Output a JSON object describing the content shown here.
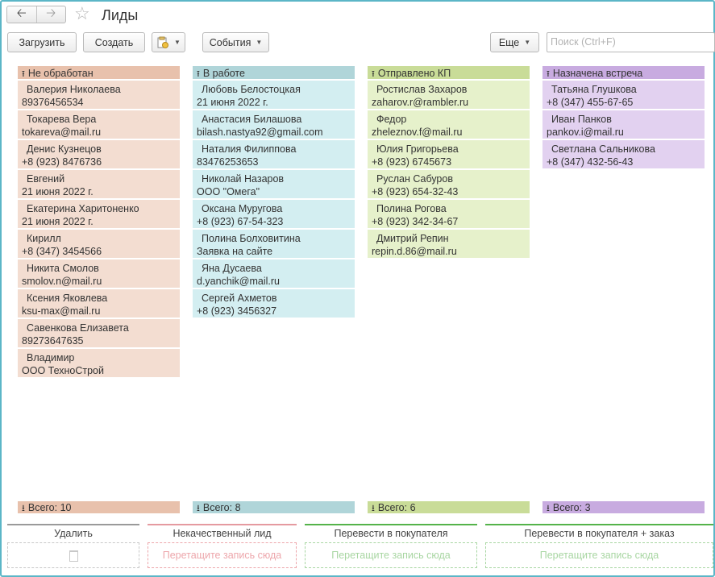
{
  "window": {
    "title": "Лиды"
  },
  "toolbar": {
    "load_label": "Загрузить",
    "create_label": "Создать",
    "events_label": "События",
    "more_label": "Еще",
    "search_placeholder": "Поиск (Ctrl+F)"
  },
  "columns": [
    {
      "title": "Не обработан",
      "total": "Всего: 10",
      "color": "#e8c1ac",
      "cards": [
        {
          "name": "Валерия Николаева",
          "contact": "89376456534"
        },
        {
          "name": "Токарева Вера",
          "contact": "tokareva@mail.ru"
        },
        {
          "name": "Денис Кузнецов",
          "contact": "+8 (923) 8476736"
        },
        {
          "name": "Евгений",
          "contact": "21 июня 2022 г."
        },
        {
          "name": "Екатерина Харитоненко",
          "contact": "21 июня 2022 г."
        },
        {
          "name": "Кирилл",
          "contact": "+8 (347) 3454566"
        },
        {
          "name": "Никита Смолов",
          "contact": "smolov.n@mail.ru"
        },
        {
          "name": "Ксения Яковлева",
          "contact": "ksu-max@mail.ru"
        },
        {
          "name": "Савенкова Елизавета",
          "contact": "89273647635"
        },
        {
          "name": "Владимир",
          "contact": "ООО ТехноСтрой"
        }
      ]
    },
    {
      "title": "В работе",
      "total": "Всего: 8",
      "color": "#b0d5d9",
      "cards": [
        {
          "name": "Любовь Белостоцкая",
          "contact": "21 июня 2022 г."
        },
        {
          "name": "Анастасия Билашова",
          "contact": "bilash.nastya92@gmail.com"
        },
        {
          "name": "Наталия Филиппова",
          "contact": "83476253653"
        },
        {
          "name": "Николай Назаров",
          "contact": "ООО \"Омега\""
        },
        {
          "name": "Оксана Муругова",
          "contact": "+8 (923) 67-54-323"
        },
        {
          "name": "Полина Болховитина",
          "contact": "Заявка на сайте"
        },
        {
          "name": "Яна Дусаева",
          "contact": "d.yanchik@mail.ru"
        },
        {
          "name": "Сергей Ахметов",
          "contact": "+8 (923) 3456327"
        }
      ]
    },
    {
      "title": "Отправлено КП",
      "total": "Всего: 6",
      "color": "#c9dc98",
      "cards": [
        {
          "name": "Ростислав Захаров",
          "contact": "zaharov.r@rambler.ru"
        },
        {
          "name": "Федор",
          "contact": "zheleznov.f@mail.ru"
        },
        {
          "name": "Юлия Григорьева",
          "contact": "+8 (923) 6745673"
        },
        {
          "name": "Руслан Сабуров",
          "contact": "+8 (923) 654-32-43"
        },
        {
          "name": "Полина Рогова",
          "contact": "+8 (923) 342-34-67"
        },
        {
          "name": "Дмитрий Репин",
          "contact": "repin.d.86@mail.ru"
        }
      ]
    },
    {
      "title": "Назначена встреча",
      "total": "Всего: 3",
      "color": "#c8abe0",
      "cards": [
        {
          "name": "Татьяна Глушкова",
          "contact": "+8 (347) 455-67-65"
        },
        {
          "name": "Иван Панков",
          "contact": "pankov.i@mail.ru"
        },
        {
          "name": "Светлана Сальникова",
          "contact": "+8 (347) 432-56-43"
        }
      ]
    }
  ],
  "dropzones": [
    {
      "label": "Удалить",
      "hint": ""
    },
    {
      "label": "Некачественный лид",
      "hint": "Перетащите запись сюда"
    },
    {
      "label": "Перевести в покупателя",
      "hint": "Перетащите запись сюда"
    },
    {
      "label": "Перевести в покупателя + заказ",
      "hint": "Перетащите запись сюда"
    }
  ],
  "icons": {
    "back": "back-arrow-icon",
    "forward": "forward-arrow-icon",
    "favorite": "star-icon",
    "column_header": "sort-up-icon",
    "column_footer": "sort-down-icon",
    "trash": "trash-icon",
    "attach": "document-clip-icon"
  }
}
